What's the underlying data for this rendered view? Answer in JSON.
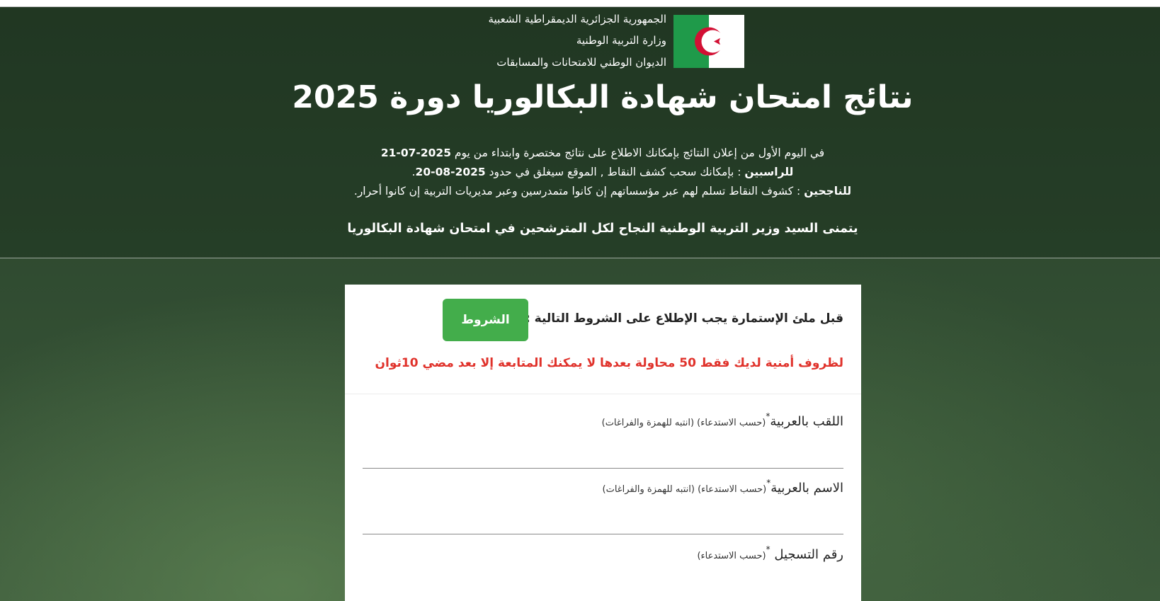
{
  "header": {
    "org_line1": "الجمهورية الجزائرية الديمقراطية الشعبية",
    "org_line2": "وزارة التربية الوطنية",
    "org_line3": "الديوان الوطني للامتحانات والمسابقات",
    "title": "نتائج امتحان شهادة البكالوريا دورة 2025",
    "info_line1_text": "في اليوم الأول من إعلان النتائج بإمكانك الاطلاع على نتائج مختصرة وابتداء من يوم ",
    "info_line1_date": "2025-07-21",
    "info_line2_label": "للراسبين",
    "info_line2_text": " : بإمكانك سحب كشف النقاط , الموقع سيغلق في حدود  ",
    "info_line2_date": "2025-08-20",
    "info_line2_end": ".",
    "info_line3_label": "للناجحين",
    "info_line3_text": " : كشوف النقاط تسلم لهم عبر مؤسساتهم إن كانوا متمدرسين وعبر مديريات التربية إن كانوا أحرار.",
    "wish": "يتمنى السيد وزير التربية الوطنية النجاح لكل المترشحين في امتحان شهادة البكالوريا",
    "flag_icon": "algeria-flag-icon"
  },
  "form": {
    "terms_text": "قبل ملئ الإستمارة يجب الإطلاع على الشروط التالية :",
    "terms_button": "الشروط",
    "warning": "لظروف أمنية لديك فقط 50 محاولة بعدها لا يمكنك المتابعة إلا بعد مضي 10ثوان",
    "surname_label": "اللقب بالعربية",
    "surname_hint": "(حسب الاستدعاء) (انتبه للهمزة والفراغات)",
    "name_label": "الاسم بالعربية",
    "name_hint": "(حسب الاستدعاء) (انتبه للهمزة والفراغات)",
    "reg_label": "رقم التسجيل ",
    "reg_hint": "(حسب الاستدعاء)",
    "required_mark": "*",
    "surname_value": "",
    "name_value": ""
  },
  "colors": {
    "button_green": "#43ad4b",
    "warning_red": "#e0322b",
    "flag_green": "#1f9a4a",
    "flag_red": "#d21034"
  }
}
